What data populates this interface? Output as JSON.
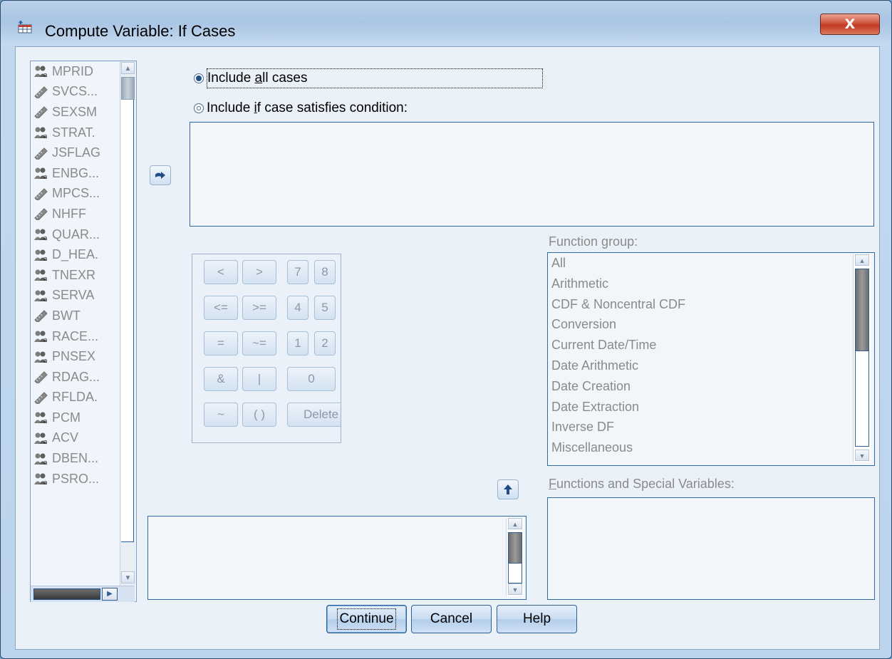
{
  "window": {
    "title": "Compute Variable: If Cases",
    "close_label": "X"
  },
  "variables": [
    {
      "name": "MPRID",
      "kind": "nominal"
    },
    {
      "name": "SVCS...",
      "kind": "scale"
    },
    {
      "name": "SEXSM",
      "kind": "scale"
    },
    {
      "name": "STRAT.",
      "kind": "nominal"
    },
    {
      "name": "JSFLAG",
      "kind": "scale"
    },
    {
      "name": "ENBG...",
      "kind": "nominal"
    },
    {
      "name": "MPCS...",
      "kind": "scale"
    },
    {
      "name": "NHFF",
      "kind": "scale"
    },
    {
      "name": "QUAR...",
      "kind": "nominal"
    },
    {
      "name": "D_HEA.",
      "kind": "nominal"
    },
    {
      "name": "TNEXR",
      "kind": "nominal"
    },
    {
      "name": "SERVA",
      "kind": "nominal"
    },
    {
      "name": "BWT",
      "kind": "scale"
    },
    {
      "name": "RACE...",
      "kind": "nominal"
    },
    {
      "name": "PNSEX",
      "kind": "nominal"
    },
    {
      "name": "RDAG...",
      "kind": "scale"
    },
    {
      "name": "RFLDA.",
      "kind": "scale"
    },
    {
      "name": "PCM",
      "kind": "nominal"
    },
    {
      "name": "ACV",
      "kind": "nominal"
    },
    {
      "name": "DBEN...",
      "kind": "nominal"
    },
    {
      "name": "PSRO...",
      "kind": "nominal"
    }
  ],
  "radios": {
    "all_cases": {
      "prefix": "Include ",
      "mnemonic": "a",
      "suffix": "ll cases",
      "selected": true
    },
    "if_condition": {
      "prefix": "Include ",
      "mnemonic": "i",
      "suffix": "f case satisfies condition:",
      "selected": false
    }
  },
  "keypad": [
    "<",
    ">",
    "7",
    "8",
    "<=",
    ">=",
    "4",
    "5",
    "=",
    "~=",
    "1",
    "2",
    "&",
    "|",
    "0",
    "~",
    "( )",
    "Delete"
  ],
  "function_group": {
    "label_prefix": "Function ",
    "label_mnemonic": "g",
    "label_suffix": "roup:",
    "items": [
      "All",
      "Arithmetic",
      "CDF & Noncentral CDF",
      "Conversion",
      "Current Date/Time",
      "Date Arithmetic",
      "Date Creation",
      "Date Extraction",
      "Inverse DF",
      "Miscellaneous"
    ]
  },
  "functions_special": {
    "label_mnemonic": "F",
    "label_suffix": "unctions and Special Variables:"
  },
  "buttons": {
    "continue": "Continue",
    "cancel": "Cancel",
    "help": "Help"
  },
  "colors": {
    "title_bar": "#b9d1ea",
    "client_bg": "#ebf1f8",
    "close_red": "#c23a22",
    "disabled_text": "#8a8a8a"
  }
}
